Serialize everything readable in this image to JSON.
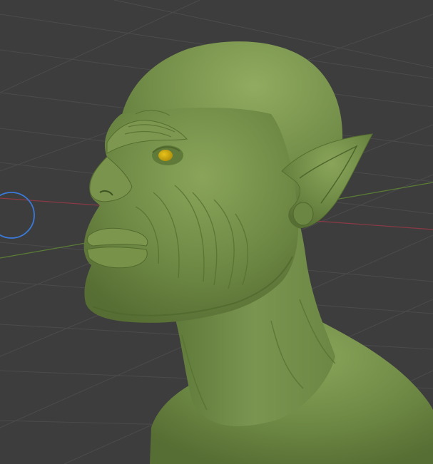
{
  "viewport": {
    "background_color": "#3d3d3d",
    "grid_line_color": "#4a4a4a",
    "x_axis_color": "#8a3a45",
    "y_axis_color": "#5a7d35"
  },
  "gizmo": {
    "icon": "brush-radius-circle-icon",
    "color": "#3a7ad9"
  },
  "model": {
    "icon": "sculpted-orc-head-bust",
    "base_color": "#6f8a45",
    "eye_color": "#c9a50e"
  }
}
